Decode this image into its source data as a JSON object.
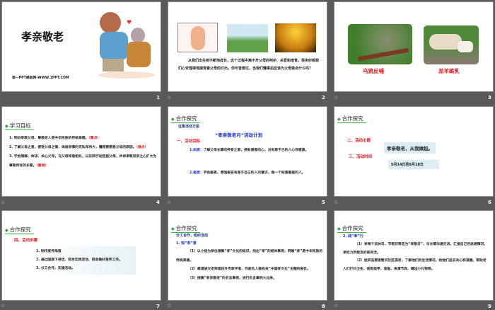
{
  "slides": [
    {
      "number": "1",
      "title": "孝亲敬老",
      "footer": "第一PPT模板网-WWW.1PPT.COM"
    },
    {
      "number": "2",
      "text": "从我们出生到不断地成长，这个过程中离不开父母的呵护、关爱和培育。很多时候我们心安理得地接受着父母的付出。你可曾想过，当我们懂事后应该为父母做点什么吗？"
    },
    {
      "number": "3",
      "captions": [
        "乌鸦反哺",
        "羔羊跪乳"
      ]
    },
    {
      "number": "4",
      "heading": "学习目标",
      "items": [
        "1. 明白孝敬父母、尊敬老人是中华民族的传统美德。",
        "2. 了解父母之爱，感受父母之情，体验亲情的无私和伟大，懂得要感恩父母的原因。",
        "3. 学会理解、体谅、关心父母，与父母和谐相处，以实际行动回报父母，并将孝敬双亲之心扩大为尊敬所有的长辈。"
      ],
      "tags": [
        "（重点）",
        "（难点）",
        "（重难）"
      ]
    },
    {
      "number": "5",
      "heading": "合作探究",
      "sub": "征集活动方案",
      "plan_title": "“孝亲敬老月”活动计划",
      "section": "一、活动目标",
      "p1_label": "1.知恩：",
      "p1": "了解父母长辈的养育之恩，拥有感恩的心，对有恩于己的人心存感激。",
      "p2_label": "2.报恩：",
      "p2": "学会报恩，增强报答有恩于自己的人的意识，做一个知恩图报的人。"
    },
    {
      "number": "6",
      "heading": "合作探究",
      "theme_label": "二、活动主题",
      "theme": "孝亲敬老，从我做起。",
      "time_label": "三、活动时间",
      "time": "5月14日至6月18日"
    },
    {
      "number": "7",
      "heading": "合作探究",
      "section": "四、活动步骤",
      "steps": [
        "1. 制作宣传海报",
        "2. 通过国旗下讲话、综合实践活动、班会做好宣传工作。",
        "3. 分工合作，实施活动。"
      ]
    },
    {
      "number": "8",
      "heading": "合作探究",
      "sub": "分工合作，组织活动",
      "section": "1. 知“孝”意",
      "items": [
        "（1）以小组为单位搜集“孝”文化的知识，找出“孝”的相关事例，明确“孝”是中华民族的传统美德。",
        "（2）邀请语文老师或校外专家学者、作家名人做有关“中国孝文化”主题的报告。",
        "（3）搜集“孝亲敬老”的名言事例，进行名言事例大比拼。"
      ]
    },
    {
      "number": "9",
      "heading": "合作探究",
      "section": "2. 践“孝”行",
      "items": [
        "（1）将每个双休日、节假日等定为“孝敬日”，与长辈沟通交流，汇报自己的思想情况，承担力所能及的家务活。",
        "（2）组织志愿者慰问社区孤老，了解他们的生活情况，给他们送去关心和温暖。帮助老人们打扫卫生、修剪指甲、读报、表演节目、赠送小礼物等。"
      ]
    }
  ],
  "icons": {
    "transition": "☆"
  }
}
